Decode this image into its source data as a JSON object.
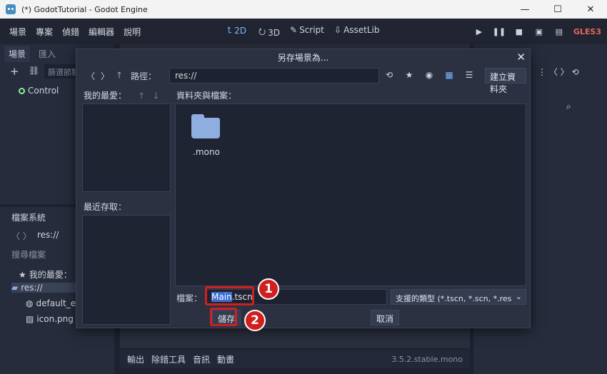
{
  "window": {
    "title": "(*) GodotTutorial - Godot Engine",
    "minimize": "—",
    "maximize": "☐",
    "close": "✕"
  },
  "menubar": {
    "menus": [
      "場景",
      "專案",
      "偵錯",
      "編輯器",
      "說明"
    ],
    "workspaces": [
      {
        "label": "2D",
        "icon": "2d-icon",
        "active": true
      },
      {
        "label": "3D",
        "icon": "3d-icon",
        "active": false
      },
      {
        "label": "Script",
        "icon": "script-icon",
        "active": false
      },
      {
        "label": "AssetLib",
        "icon": "assetlib-icon",
        "active": false
      }
    ],
    "renderer": "GLES3"
  },
  "scene_dock": {
    "tabs": [
      "場景",
      "匯入"
    ],
    "filter_placeholder": "篩選節點",
    "root_node": "Control"
  },
  "filesystem_dock": {
    "title": "檔案系統",
    "path": "res://",
    "search_placeholder": "搜尋檔案",
    "favorites": "我的最愛：",
    "items": [
      "res://",
      "default_en",
      "icon.png"
    ]
  },
  "bottom_panel": {
    "tabs": [
      "輸出",
      "除錯工具",
      "音訊",
      "動畫"
    ],
    "version": "3.5.2.stable.mono"
  },
  "dialog": {
    "title": "另存場景為...",
    "path_label": "路徑：",
    "path_value": "res://",
    "make_folder": "建立資料夾",
    "favorites_label": "我的最愛：",
    "recent_label": "最近存取：",
    "files_label": "資料夾與檔案：",
    "folders": [
      ".mono"
    ],
    "file_label": "檔案：",
    "file_selected": "Main",
    "file_rest": ".tscn",
    "filter": "支援的類型 (*.tscn, *.scn, *.res",
    "save": "儲存",
    "cancel": "取消"
  },
  "annotations": {
    "step1": "1",
    "step2": "2",
    "color": "#d0201e"
  },
  "colors": {
    "accent": "#7ab5ff",
    "folder": "#8faee0",
    "renderer": "#e8635f"
  }
}
